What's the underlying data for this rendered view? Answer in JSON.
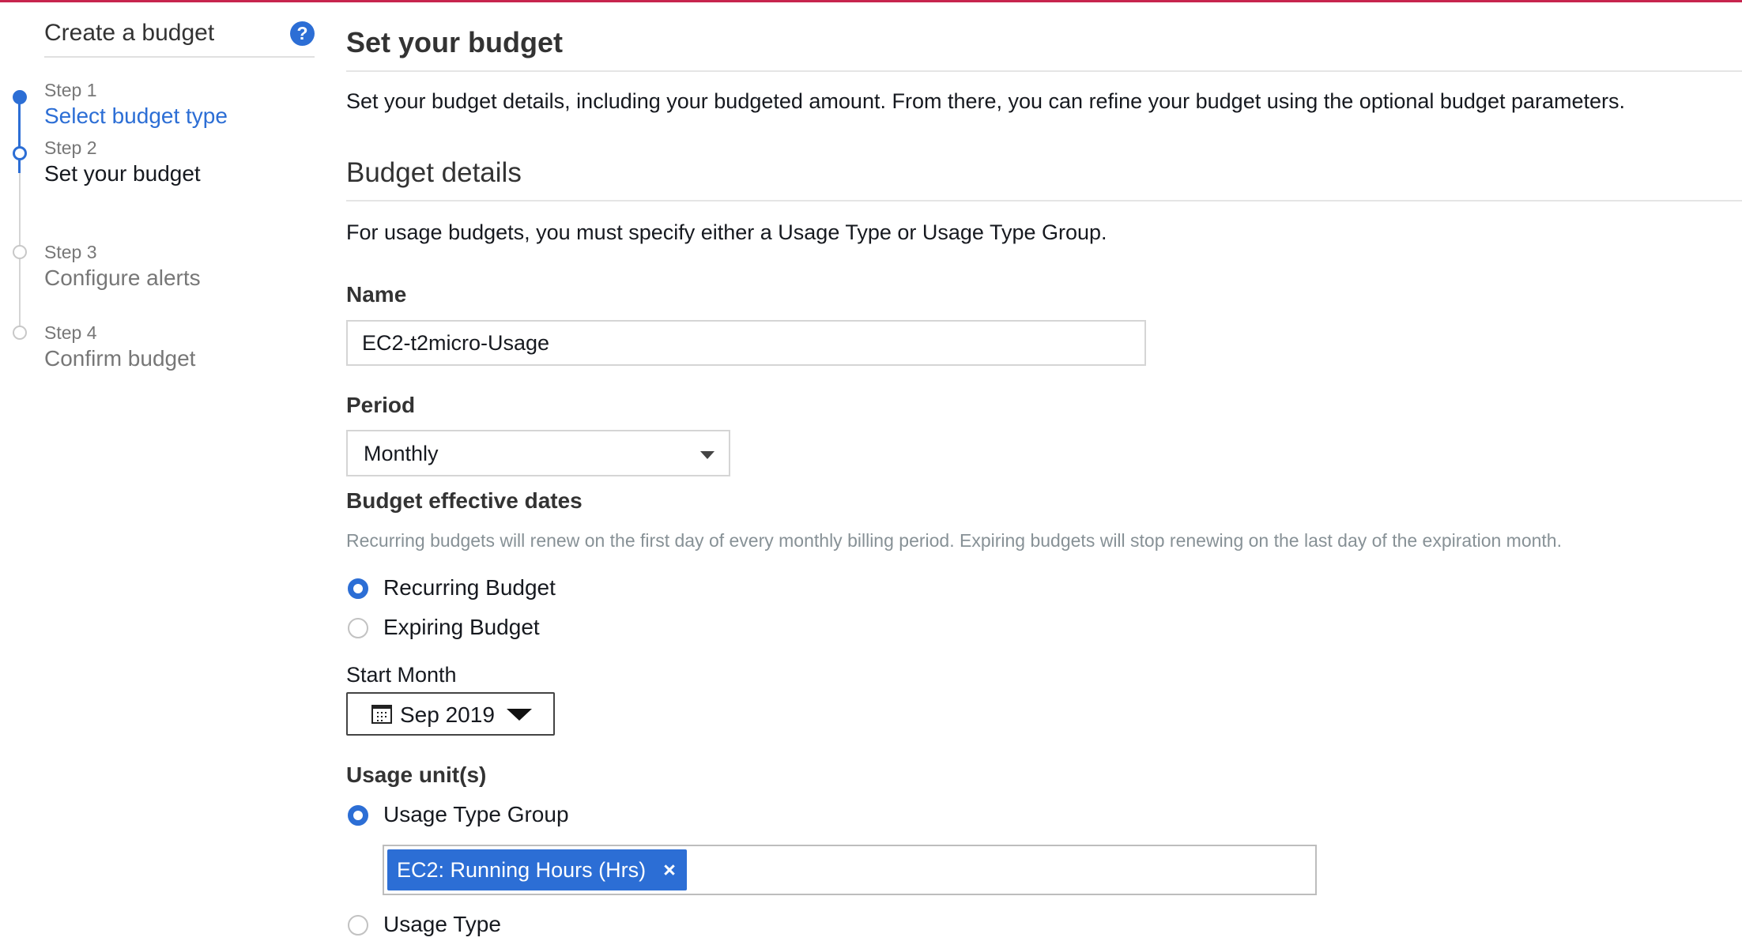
{
  "sidebar": {
    "title": "Create a budget",
    "help_icon": "help-icon",
    "steps": [
      {
        "number": "Step 1",
        "label": "Select budget type",
        "state": "done"
      },
      {
        "number": "Step 2",
        "label": "Set your budget",
        "state": "current"
      },
      {
        "number": "Step 3",
        "label": "Configure alerts",
        "state": "todo"
      },
      {
        "number": "Step 4",
        "label": "Confirm budget",
        "state": "todo"
      }
    ]
  },
  "main": {
    "title": "Set your budget",
    "intro": "Set your budget details, including your budgeted amount. From there, you can refine your budget using the optional budget parameters.",
    "section_title": "Budget details",
    "usage_note": "For usage budgets, you must specify either a Usage Type or Usage Type Group.",
    "name": {
      "label": "Name",
      "value": "EC2-t2micro-Usage"
    },
    "period": {
      "label": "Period",
      "value": "Monthly"
    },
    "effective_dates": {
      "label": "Budget effective dates",
      "help": "Recurring budgets will renew on the first day of every monthly billing period. Expiring budgets will stop renewing on the last day of the expiration month.",
      "options": [
        {
          "label": "Recurring Budget",
          "selected": true
        },
        {
          "label": "Expiring Budget",
          "selected": false
        }
      ]
    },
    "start_month": {
      "label": "Start Month",
      "value": "Sep 2019",
      "icon": "calendar-icon"
    },
    "usage_units": {
      "label": "Usage unit(s)",
      "options": [
        {
          "label": "Usage Type Group",
          "selected": true
        },
        {
          "label": "Usage Type",
          "selected": false
        }
      ],
      "tokens": [
        {
          "label": "EC2: Running Hours (Hrs)",
          "remove": "×"
        }
      ]
    }
  },
  "colors": {
    "accent": "#2c6ed5",
    "top_bar": "#c7254e",
    "muted_text": "#879196"
  }
}
